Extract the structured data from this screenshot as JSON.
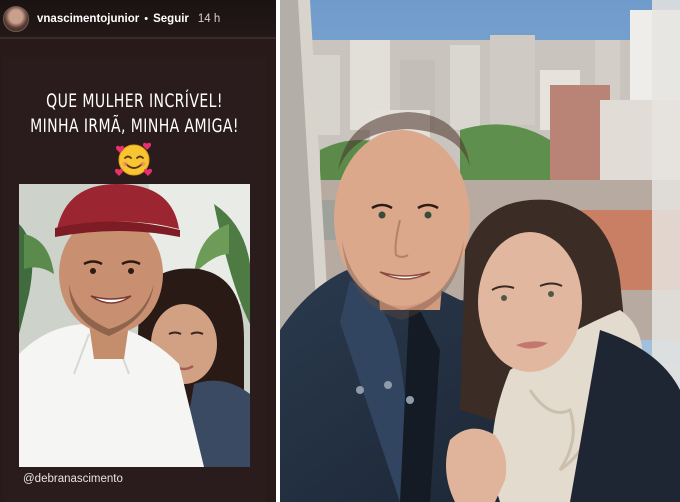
{
  "story": {
    "header": {
      "username": "vnascimentojunior",
      "separator": "•",
      "follow_label": "Seguir",
      "time": "14 h"
    },
    "caption_line_1": "QUE MULHER INCRÍVEL!",
    "caption_line_2": "MINHA IRMÃ, MINHA AMIGA!",
    "emoji": "smiling-face-with-hearts",
    "mention": "@debranascimento"
  },
  "colors": {
    "story_background": "#291a1a",
    "sky": "#8eb2d4"
  }
}
